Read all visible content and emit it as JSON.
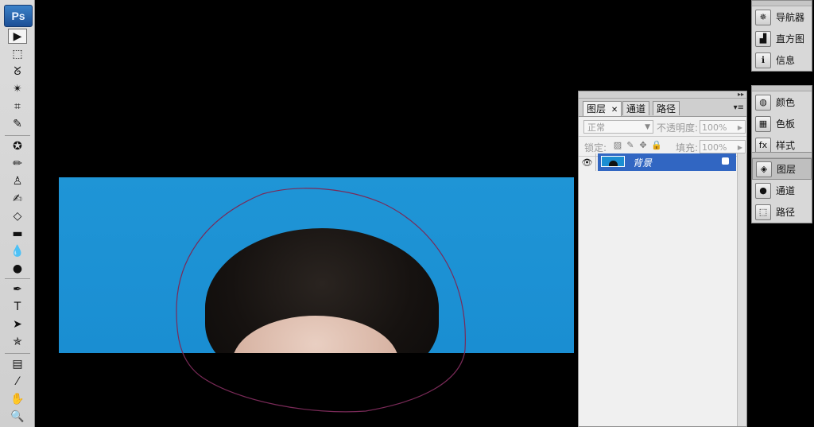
{
  "app": {
    "logo_text": "Ps"
  },
  "toolbox": {
    "tools": [
      {
        "name": "move-tool-icon",
        "glyph": "▶",
        "active": true
      },
      {
        "name": "marquee-tool-icon",
        "glyph": "⬚"
      },
      {
        "name": "lasso-tool-icon",
        "glyph": "ᘜ"
      },
      {
        "name": "magic-wand-tool-icon",
        "glyph": "✴"
      },
      {
        "name": "crop-tool-icon",
        "glyph": "⌗"
      },
      {
        "name": "slice-tool-icon",
        "glyph": "✎"
      },
      {
        "name": "healing-brush-tool-icon",
        "glyph": "✪"
      },
      {
        "name": "brush-tool-icon",
        "glyph": "✏"
      },
      {
        "name": "clone-stamp-tool-icon",
        "glyph": "♙"
      },
      {
        "name": "history-brush-tool-icon",
        "glyph": "✍"
      },
      {
        "name": "eraser-tool-icon",
        "glyph": "◇"
      },
      {
        "name": "gradient-tool-icon",
        "glyph": "▬"
      },
      {
        "name": "blur-tool-icon",
        "glyph": "💧"
      },
      {
        "name": "dodge-tool-icon",
        "glyph": "●"
      },
      {
        "name": "pen-tool-icon",
        "glyph": "✒"
      },
      {
        "name": "type-tool-icon",
        "glyph": "T"
      },
      {
        "name": "path-selection-tool-icon",
        "glyph": "➤"
      },
      {
        "name": "shape-tool-icon",
        "glyph": "✯"
      },
      {
        "name": "notes-tool-icon",
        "glyph": "▤"
      },
      {
        "name": "eyedropper-tool-icon",
        "glyph": "⁄"
      },
      {
        "name": "hand-tool-icon",
        "glyph": "✋"
      },
      {
        "name": "zoom-tool-icon",
        "glyph": "🔍"
      }
    ]
  },
  "layers_panel": {
    "tabs": [
      {
        "label": "图层",
        "active": true,
        "closable": true
      },
      {
        "label": "通道"
      },
      {
        "label": "路径"
      }
    ],
    "blend_mode": "正常",
    "opacity_label": "不透明度:",
    "opacity_value": "100%",
    "lock_label": "锁定:",
    "fill_label": "填充:",
    "fill_value": "100%",
    "layer": {
      "name": "背景"
    }
  },
  "dock": {
    "groups": [
      {
        "items": [
          {
            "label": "导航器",
            "icon": "navigator-icon",
            "glyph": "✵"
          },
          {
            "label": "直方图",
            "icon": "histogram-icon",
            "glyph": "▟"
          },
          {
            "label": "信息",
            "icon": "info-icon",
            "glyph": "ℹ"
          }
        ]
      },
      {
        "items": [
          {
            "label": "颜色",
            "icon": "color-icon",
            "glyph": "◍"
          },
          {
            "label": "色板",
            "icon": "swatches-icon",
            "glyph": "▦"
          },
          {
            "label": "样式",
            "icon": "styles-icon",
            "glyph": "fx"
          }
        ]
      },
      {
        "items": [
          {
            "label": "图层",
            "icon": "layers-icon",
            "glyph": "◈",
            "selected": true
          },
          {
            "label": "通道",
            "icon": "channels-icon",
            "glyph": "●"
          },
          {
            "label": "路径",
            "icon": "paths-icon",
            "glyph": "⬚"
          }
        ]
      }
    ]
  }
}
